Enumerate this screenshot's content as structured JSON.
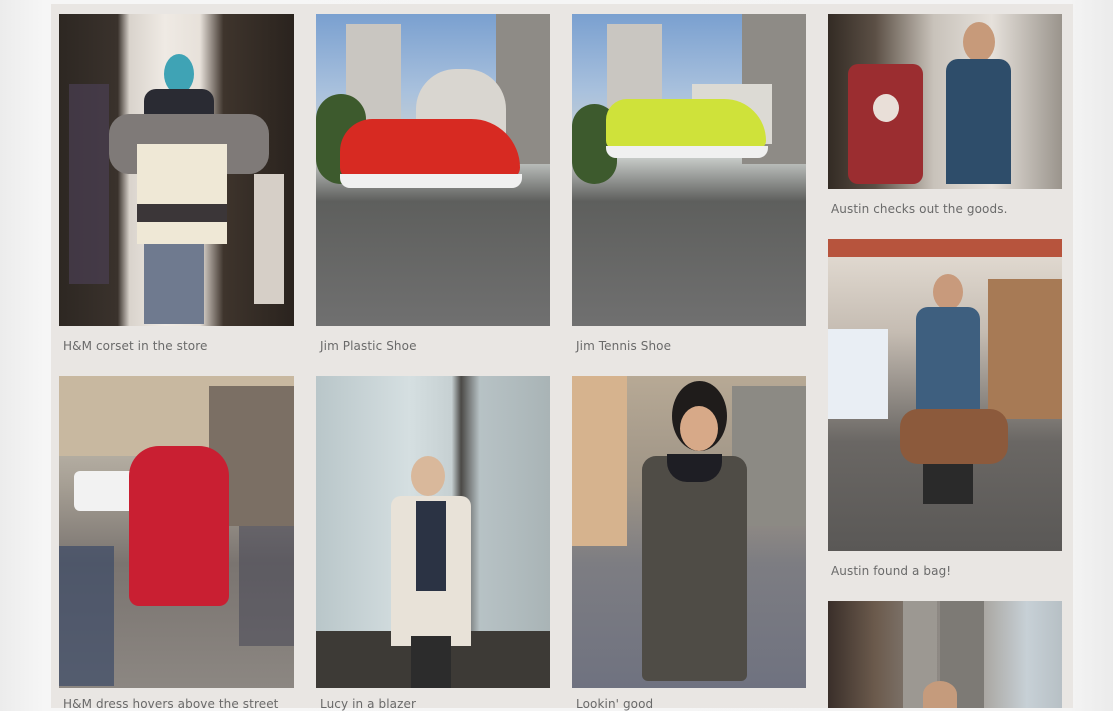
{
  "gallery": {
    "items": [
      {
        "caption": "H&M corset in the store"
      },
      {
        "caption": "Jim Plastic Shoe"
      },
      {
        "caption": "Jim Tennis Shoe"
      },
      {
        "caption": "Austin checks out the goods."
      },
      {
        "caption": "Austin found a bag!"
      },
      {
        "caption": "H&M dress hovers above the street"
      },
      {
        "caption": "Lucy in a blazer"
      },
      {
        "caption": "Lookin' good"
      }
    ]
  }
}
